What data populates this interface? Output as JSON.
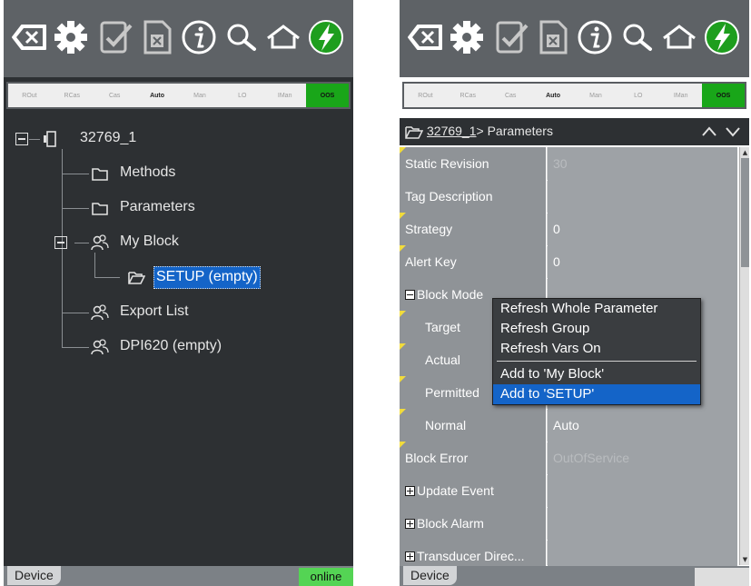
{
  "mode_labels": [
    "ROut",
    "RCas",
    "Cas",
    "Auto",
    "Man",
    "LO",
    "IMan",
    "OOS"
  ],
  "left": {
    "root_label": "32769_1",
    "tree": [
      {
        "label": "Methods"
      },
      {
        "label": "Parameters"
      },
      {
        "label": "My Block"
      },
      {
        "label": "SETUP (empty)"
      },
      {
        "label": "Export List"
      },
      {
        "label": "DPI620 (empty)"
      }
    ],
    "device_tab": "Device",
    "status": "online"
  },
  "right": {
    "path_link": "32769_1",
    "path_rest": "> Parameters",
    "rows": [
      {
        "name": "Static Revision",
        "value": "30"
      },
      {
        "name": "Tag Description",
        "value": ""
      },
      {
        "name": "Strategy",
        "value": "0"
      },
      {
        "name": "Alert Key",
        "value": "0"
      },
      {
        "name": "Block Mode",
        "value": ""
      },
      {
        "name": "Target",
        "value": ""
      },
      {
        "name": "Actual",
        "value": ""
      },
      {
        "name": "Permitted",
        "value": ""
      },
      {
        "name": "Normal",
        "value": "Auto"
      },
      {
        "name": "Block Error",
        "value": "OutOfService"
      },
      {
        "name": "Update Event",
        "value": ""
      },
      {
        "name": "Block Alarm",
        "value": ""
      },
      {
        "name": "Transducer Direc...",
        "value": ""
      }
    ],
    "context_menu": [
      "Refresh Whole Parameter",
      "Refresh Group",
      "Refresh Vars On",
      "Add to 'My Block'",
      "Add to 'SETUP'"
    ],
    "device_tab": "Device"
  },
  "colors": {
    "accent": "#1464c8",
    "oos": "#19a619",
    "online": "#54d454",
    "toolbar": "#5e6266",
    "panel": "#2d3033"
  },
  "icons": [
    "backspace-icon",
    "gear-icon",
    "checklist-icon",
    "cancel-document-icon",
    "info-icon",
    "search-icon",
    "home-icon",
    "lightning-icon"
  ]
}
